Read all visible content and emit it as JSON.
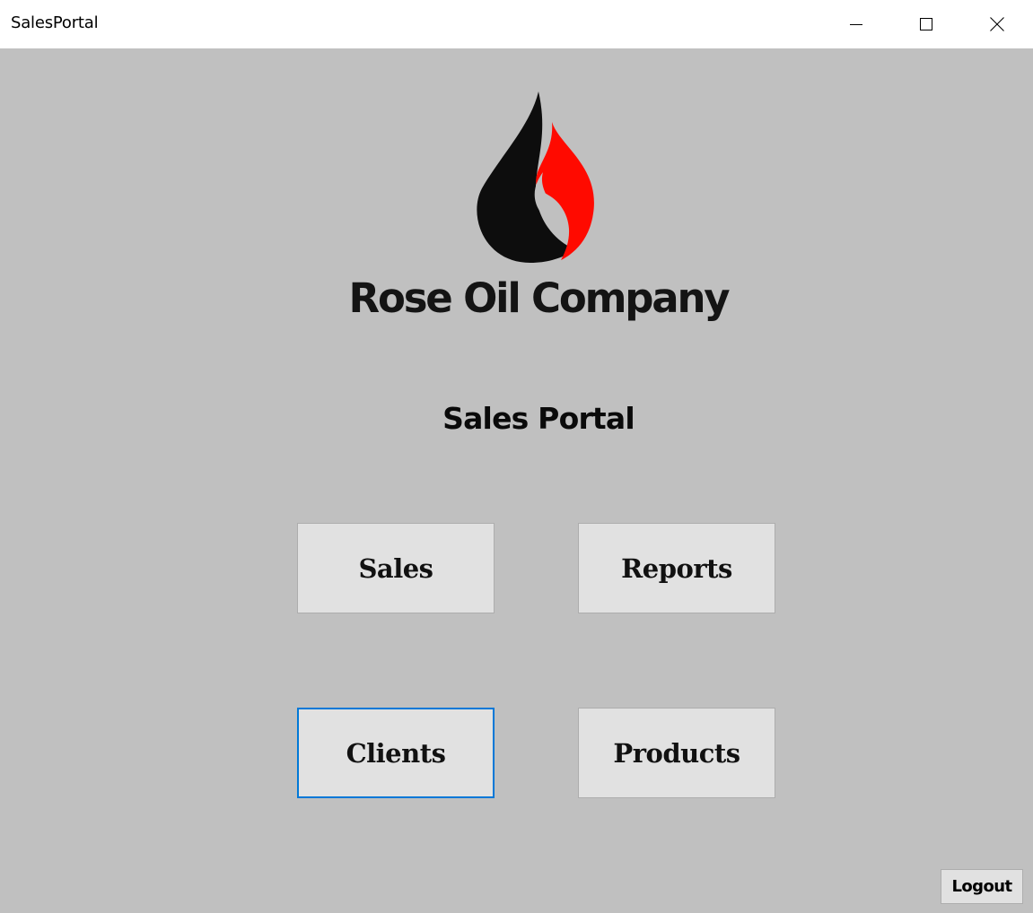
{
  "window": {
    "title": "SalesPortal"
  },
  "branding": {
    "logo_icon": "flame-drop-logo",
    "company_name": "Rose Oil Company",
    "colors": {
      "drop": "#0d0d0d",
      "flame": "#ff0a00"
    }
  },
  "page": {
    "title": "Sales Portal"
  },
  "menu": {
    "sales_label": "Sales",
    "reports_label": "Reports",
    "clients_label": "Clients",
    "products_label": "Products",
    "focused": "Clients"
  },
  "footer": {
    "logout_label": "Logout"
  },
  "theme": {
    "background": "#c0c0c0",
    "button_face": "#e1e1e1",
    "focus_border": "#0078d7"
  }
}
